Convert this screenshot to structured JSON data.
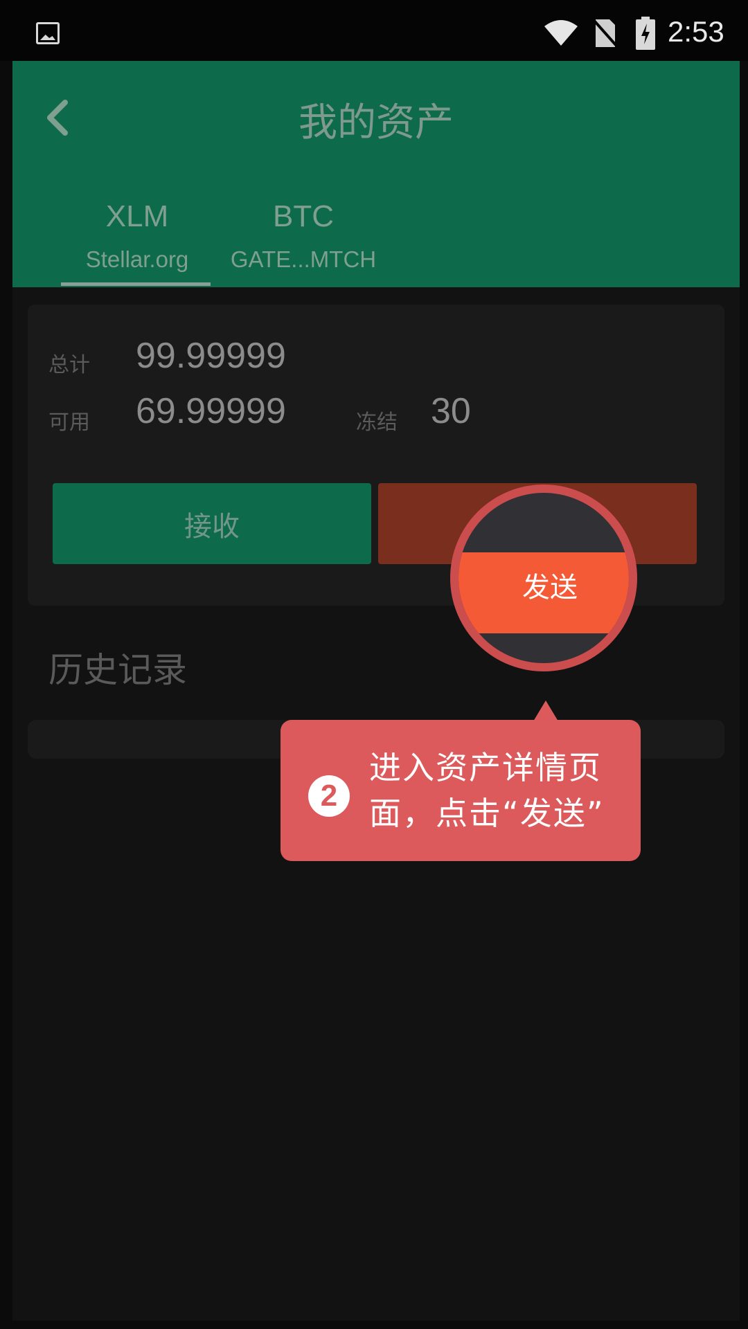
{
  "status_bar": {
    "time": "2:53",
    "icons": [
      "gallery-icon",
      "wifi-icon",
      "no-sim-icon",
      "battery-icon"
    ]
  },
  "header": {
    "title": "我的资产",
    "back_icon": "chevron-left-icon"
  },
  "tabs": [
    {
      "symbol": "XLM",
      "issuer": "Stellar.org",
      "selected": true
    },
    {
      "symbol": "BTC",
      "issuer": "GATE...MTCH",
      "selected": false
    }
  ],
  "balance": {
    "total_label": "总计",
    "total_value": "99.99999",
    "available_label": "可用",
    "available_value": "69.99999",
    "frozen_label": "冻结",
    "frozen_value": "30"
  },
  "actions": {
    "receive_label": "接收",
    "send_label": "发送"
  },
  "history": {
    "title": "历史记录"
  },
  "tutorial": {
    "step_number": "2",
    "text": "进入资产详情页面，点击“发送”"
  },
  "colors": {
    "header_bg": "#0d6a4a",
    "send_button": "#f35a35",
    "callout_bg": "#dc5a5c",
    "highlight_ring": "#cc4d4d"
  }
}
